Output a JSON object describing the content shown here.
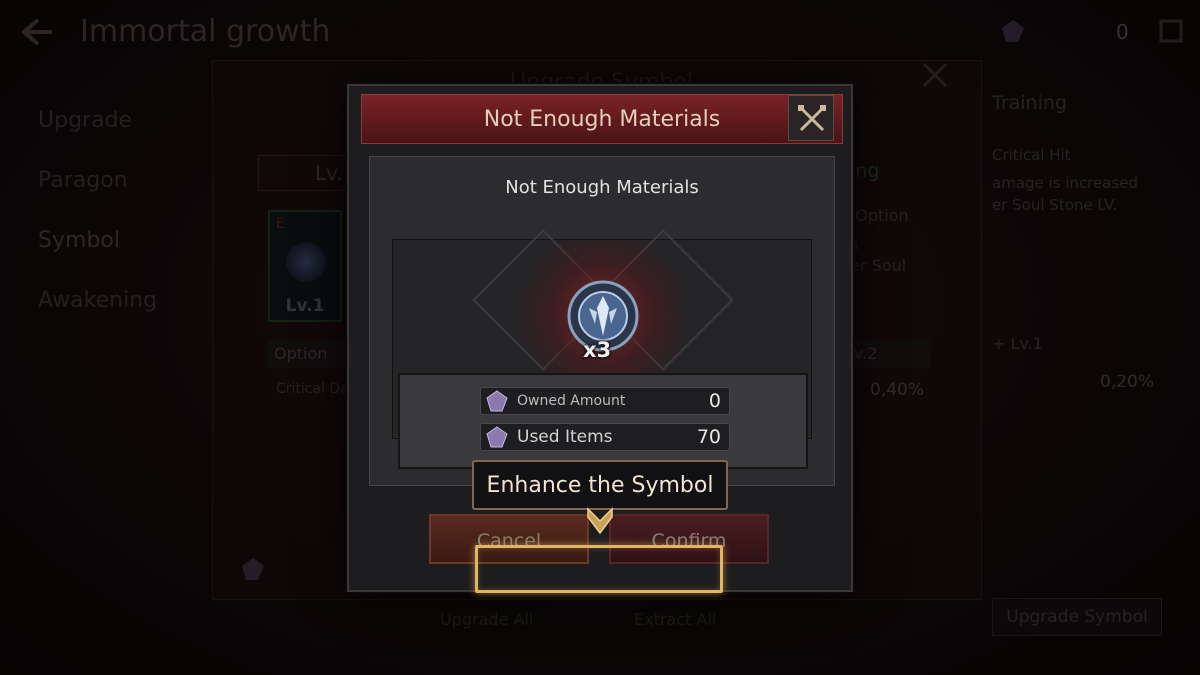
{
  "background": {
    "page_heading": "Immortal growth",
    "currency_count": "0",
    "menu": [
      "Upgrade",
      "Paragon",
      "Symbol",
      "Awakening"
    ],
    "panel_title": "Upgrade Symbol",
    "level_tab": "Lv.",
    "card_grade": "E",
    "card_level": "Lv.1",
    "option_label": "Option",
    "critical_label": "Critical Da",
    "green_status": "ing",
    "right_texts": [
      "d Option",
      "s",
      "per Soul"
    ],
    "level_two_tab": "Lv.2",
    "pct_value": "0,40%",
    "right_panel_title": "Training",
    "right_panel_texts": [
      "Critical Hit",
      "amage is increased",
      "er Soul Stone LV."
    ],
    "right_level": "+ Lv.1",
    "right_pct": "0,20%",
    "upgrade_symbol_button": "Upgrade Symbol",
    "upgrade_all": "Upgrade All",
    "extract_all": "Extract All"
  },
  "modal": {
    "title": "Not Enough Materials",
    "inner_title": "Not Enough Materials",
    "item_quantity": "x3",
    "stats": [
      {
        "label": "Owned Amount",
        "value": "0"
      },
      {
        "label": "Used Items",
        "value": "70"
      }
    ],
    "cancel_label": "Cancel",
    "confirm_label": "Confirm"
  },
  "tutorial": {
    "tooltip_text": "Enhance the Symbol"
  },
  "colors": {
    "accent_gold": "#e2b560",
    "header_red": "#7a2226",
    "panel_bg": "#2c2b2e"
  }
}
